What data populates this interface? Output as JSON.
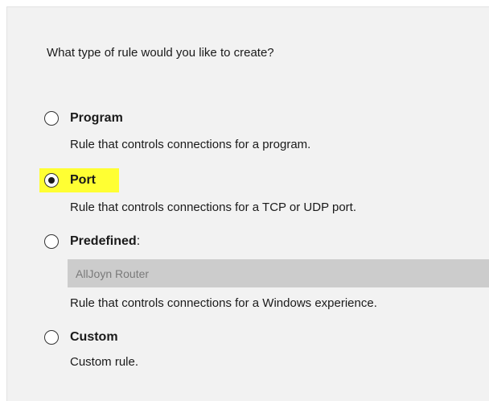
{
  "question": "What type of rule would you like to create?",
  "options": [
    {
      "id": "program",
      "label": "Program",
      "description": "Rule that controls connections for a program.",
      "selected": false
    },
    {
      "id": "port",
      "label": "Port",
      "description": "Rule that controls connections for a TCP or UDP port.",
      "selected": true,
      "highlight_color": "#ffff33"
    },
    {
      "id": "predefined",
      "label": "Predefined",
      "label_suffix": ":",
      "dropdown_value": "AllJoyn Router",
      "description": "Rule that controls connections for a Windows experience.",
      "selected": false
    },
    {
      "id": "custom",
      "label": "Custom",
      "description": "Custom rule.",
      "selected": false
    }
  ],
  "colors": {
    "panel_background": "#f2f2f2",
    "highlight": "#ffff33",
    "dropdown_background": "#cccccc",
    "dropdown_text": "#7a7a7a"
  }
}
